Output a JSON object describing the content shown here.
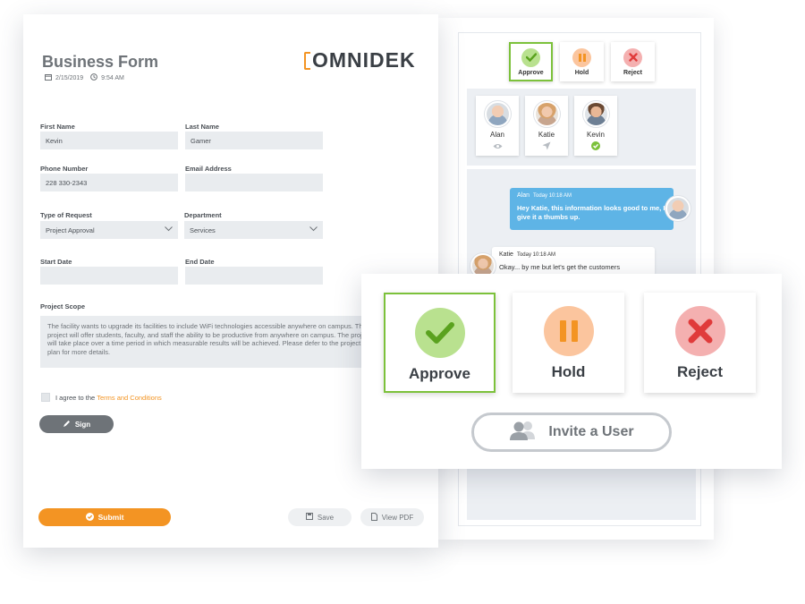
{
  "form": {
    "title": "Business Form",
    "date": "2/15/2019",
    "time": "9:54 AM",
    "logo_text": "OMNIDEK",
    "fields": {
      "first_name": {
        "label": "First Name",
        "value": "Kevin"
      },
      "last_name": {
        "label": "Last Name",
        "value": "Gamer"
      },
      "phone": {
        "label": "Phone Number",
        "value": "228 330-2343"
      },
      "email": {
        "label": "Email Address",
        "value": ""
      },
      "request_type": {
        "label": "Type of Request",
        "value": "Project Approval"
      },
      "department": {
        "label": "Department",
        "value": "Services"
      },
      "start_date": {
        "label": "Start Date",
        "value": ""
      },
      "end_date": {
        "label": "End Date",
        "value": ""
      },
      "scope": {
        "label": "Project Scope",
        "value": "The facility wants to upgrade its facilities to include WiFi technologies accessible anywhere on campus. The project will offer students, faculty, and staff the ability to be productive from anywhere on campus. The project will take place over a time period in which measurable results will be achieved. Please defer to the project plan for more details."
      }
    },
    "agree_prefix": "I agree to the",
    "agree_link": "Terms and Conditions",
    "sign_label": "Sign",
    "submit_label": "Submit",
    "save_label": "Save",
    "pdf_label": "View PDF"
  },
  "mini_actions": {
    "approve": "Approve",
    "hold": "Hold",
    "reject": "Reject"
  },
  "users": [
    {
      "name": "Alan",
      "status_icon": "eye-icon"
    },
    {
      "name": "Katie",
      "status_icon": "send-icon"
    },
    {
      "name": "Kevin",
      "status_icon": "check-circle-icon"
    }
  ],
  "chat": [
    {
      "author": "Alan",
      "time": "Today 10:18 AM",
      "message": "Hey Katie, this information looks good to me, I give it a thumbs up."
    },
    {
      "author": "Katie",
      "time": "Today 10:18 AM",
      "message": "Okay... by me but let's get the customers"
    }
  ],
  "popover": {
    "approve": "Approve",
    "hold": "Hold",
    "reject": "Reject",
    "invite": "Invite a User"
  },
  "colors": {
    "accent_orange": "#f39423",
    "approve_green": "#7cc13b",
    "hold_orange": "#fbbf92",
    "reject_red": "#f2a9a9",
    "chat_blue": "#5eb4e6"
  }
}
